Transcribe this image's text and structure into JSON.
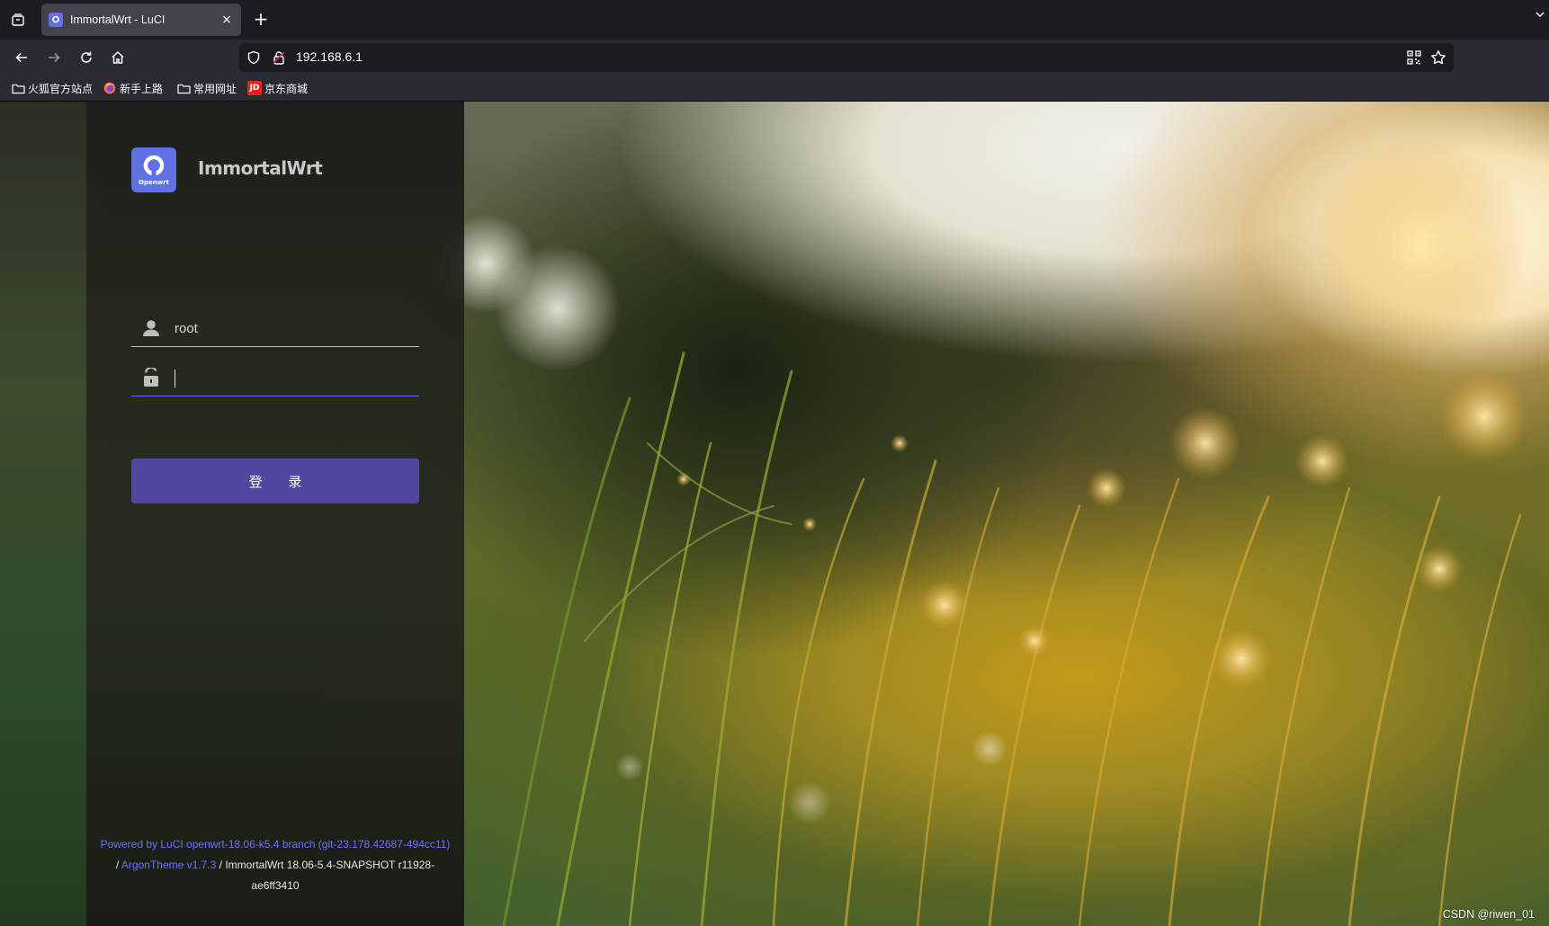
{
  "browser": {
    "tab": {
      "title": "ImmortalWrt - LuCI",
      "close": "×"
    },
    "new_tab": "+",
    "url": "192.168.6.1",
    "bookmarks": [
      {
        "label": "火狐官方站点",
        "icon": "folder-icon"
      },
      {
        "label": "新手上路",
        "icon": "firefox-icon"
      },
      {
        "label": "常用网址",
        "icon": "folder-icon"
      },
      {
        "label": "京东商城",
        "icon": "jd-icon",
        "icon_text": "JD"
      }
    ]
  },
  "login": {
    "brand": {
      "logo_text": "Openwrt",
      "name": "ImmortalWrt"
    },
    "username": {
      "value": "root"
    },
    "password": {
      "value": ""
    },
    "submit_label": "登 录",
    "colors": {
      "accent": "#5e72e4",
      "button": "#4f47a0",
      "link": "#6f6fff"
    }
  },
  "footer": {
    "powered_by": "Powered by LuCI openwrt-18.06-k5.4 branch (git-23.178.42687-494cc11)",
    "separator1": "/",
    "theme": "ArgonTheme v1.7.3",
    "version_line": "/ ImmortalWrt 18.06-5.4-SNAPSHOT r11928-",
    "version_tail": "ae6ff3410"
  },
  "watermark": "CSDN @riwen_01"
}
